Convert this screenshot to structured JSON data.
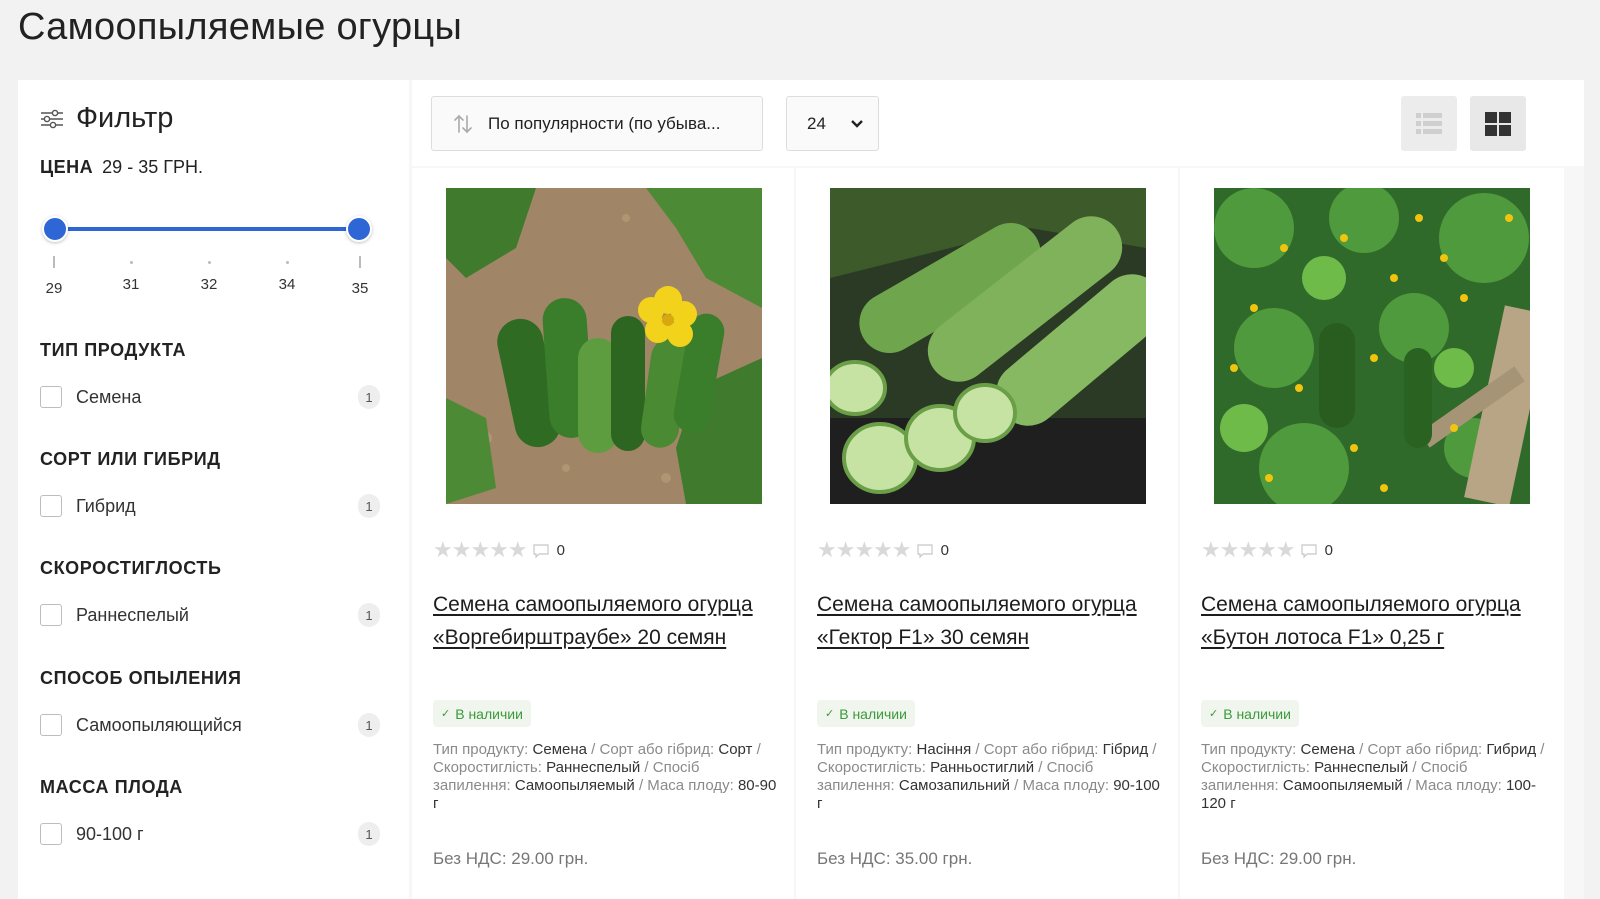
{
  "page": {
    "title": "Самоопыляемые огурцы"
  },
  "filter": {
    "title": "Фильтр",
    "icon": "sliders-icon",
    "price": {
      "label": "ЦЕНА",
      "range_text": "29 - 35 ГРН.",
      "min": 29,
      "max": 35,
      "ticks": [
        "29",
        "31",
        "32",
        "34",
        "35"
      ]
    },
    "facets": [
      {
        "title": "ТИП ПРОДУКТА",
        "option": "Семена",
        "count": "1"
      },
      {
        "title": "СОРТ ИЛИ ГИБРИД",
        "option": "Гибрид",
        "count": "1"
      },
      {
        "title": "СКОРОСТИГЛОСТЬ",
        "option": "Раннеспелый",
        "count": "1"
      },
      {
        "title": "СПОСОБ ОПЫЛЕНИЯ",
        "option": "Самоопыляющийся",
        "count": "1"
      },
      {
        "title": "МАССА ПЛОДА",
        "option": "90-100 г",
        "count": "1"
      }
    ]
  },
  "toolbar": {
    "sort_label": "По популярности (по убыва...",
    "per_page": "24",
    "view_list_icon": "list-view-icon",
    "view_grid_icon": "grid-view-icon",
    "accent": "#2f66d6"
  },
  "products": [
    {
      "name": "Семена самоопыляемого огурца «Воргебирштраубе» 20 семян",
      "reviews": "0",
      "stock": "В наличии",
      "spec_parts": [
        [
          "Тип продукту: ",
          "Семена",
          " / Сорт або гібрид: "
        ],
        [
          "",
          "Сорт",
          " / Скоростиглість: "
        ],
        [
          "",
          "Раннеспелый",
          " / Спосіб запилення: "
        ],
        [
          "",
          "Самоопыляемый",
          " / Маса плоду: "
        ],
        [
          "",
          "80-90 г",
          ""
        ]
      ],
      "price_novat": "Без НДС: 29.00 грн."
    },
    {
      "name": "Семена самоопыляемого огурца «Гектор F1» 30 семян",
      "reviews": "0",
      "stock": "В наличии",
      "spec_parts": [
        [
          "Тип продукту: ",
          "Насіння",
          " / Сорт або гібрид: "
        ],
        [
          "",
          "Гібрид",
          " / Скоростиглість: "
        ],
        [
          "",
          "Ранньостиглий",
          " / Спосіб запилення: "
        ],
        [
          "",
          "Самозапильний",
          " / Маса плоду: "
        ],
        [
          "",
          "90-100 г",
          ""
        ]
      ],
      "price_novat": "Без НДС: 35.00 грн."
    },
    {
      "name": "Семена самоопыляемого огурца «Бутон лотоса F1» 0,25 г",
      "reviews": "0",
      "stock": "В наличии",
      "spec_parts": [
        [
          "Тип продукту: ",
          "Семена",
          " / Сорт або гібрид: "
        ],
        [
          "",
          "Гибрид",
          " / Скоростиглість: "
        ],
        [
          "",
          "Раннеспелый",
          " / Спосіб запилення: "
        ],
        [
          "",
          "Самоопыляемый",
          " / Маса плоду: "
        ],
        [
          "",
          "100-120 г",
          ""
        ]
      ],
      "price_novat": "Без НДС: 29.00 грн."
    }
  ]
}
